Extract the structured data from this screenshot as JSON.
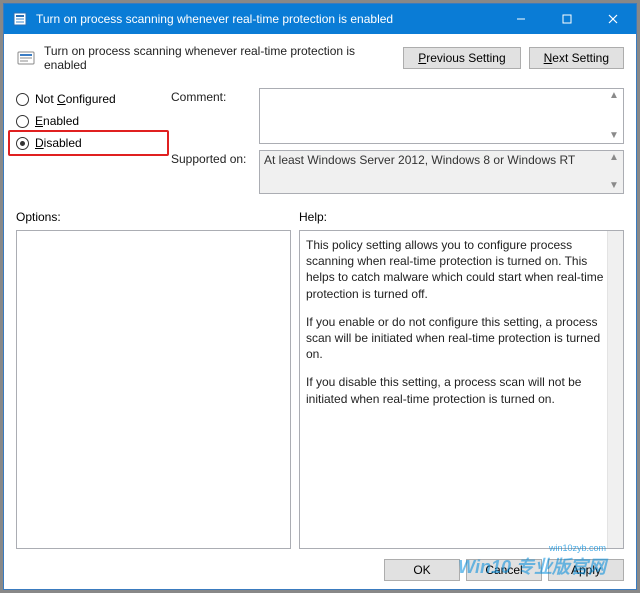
{
  "window": {
    "title": "Turn on process scanning whenever real-time protection is enabled"
  },
  "header": {
    "policy_title": "Turn on process scanning whenever real-time protection is enabled",
    "prev_prefix": "P",
    "prev_rest": "revious Setting",
    "next_prefix": "N",
    "next_rest": "ext Setting"
  },
  "radios": {
    "not_configured_u": "C",
    "not_configured_pre": "Not ",
    "not_configured_post": "onfigured",
    "enabled_u": "E",
    "enabled_post": "nabled",
    "disabled_u": "D",
    "disabled_post": "isabled",
    "selected": "disabled"
  },
  "fields": {
    "comment_label": "Comment:",
    "comment_value": "",
    "supported_label": "Supported on:",
    "supported_value": "At least Windows Server 2012, Windows 8 or Windows RT"
  },
  "panes": {
    "options_label": "Options:",
    "help_label": "Help:",
    "help_p1": "This policy setting allows you to configure process scanning when real-time protection is turned on. This helps to catch malware which could start when real-time protection is turned off.",
    "help_p2": "    If you enable or do not configure this setting,  a process scan will be initiated when real-time protection is turned on.",
    "help_p3": "    If you disable this setting, a process scan will not be initiated when real-time protection is turned on."
  },
  "footer": {
    "ok": "OK",
    "cancel": "Cancel",
    "apply": "Apply"
  },
  "watermark": {
    "small": "win10zyb.com",
    "big": "Win10 专业版官网"
  }
}
